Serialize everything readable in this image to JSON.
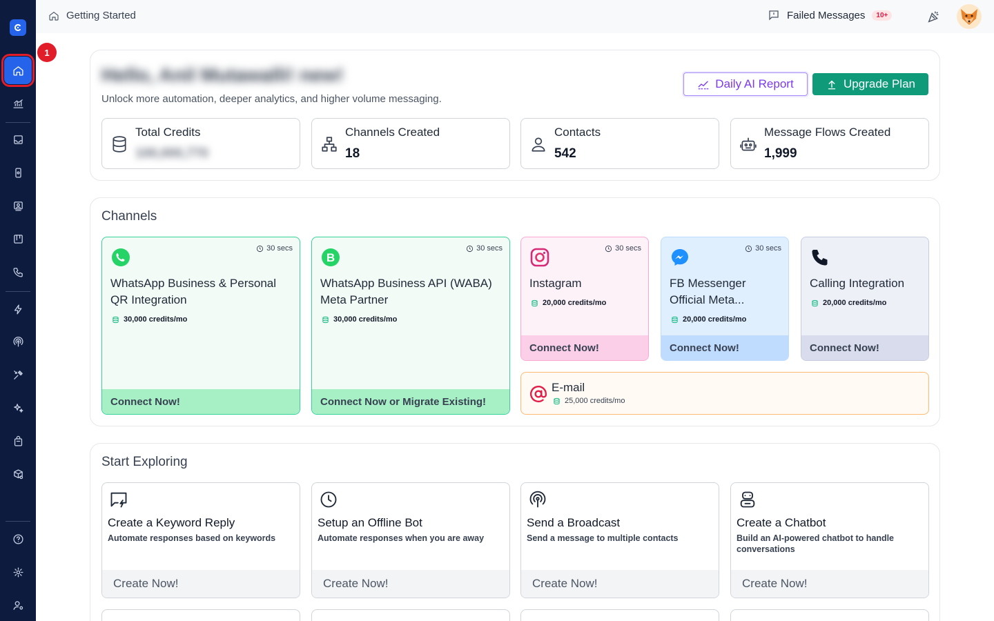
{
  "breadcrumb": {
    "label": "Getting Started"
  },
  "topbar": {
    "failed_label": "Failed Messages",
    "failed_count": "10+"
  },
  "tutorial": {
    "step": "1"
  },
  "hero": {
    "greeting": "Hello, Anil Mutawalli! new!",
    "subtitle": "Unlock more automation, deeper analytics, and higher volume messaging.",
    "ai_report_label": "Daily AI Report",
    "upgrade_label": "Upgrade Plan"
  },
  "stats": [
    {
      "label": "Total Credits",
      "value": "100,000,770",
      "icon": "database-icon"
    },
    {
      "label": "Channels Created",
      "value": "18",
      "icon": "hierarchy-icon"
    },
    {
      "label": "Contacts",
      "value": "542",
      "icon": "user-icon"
    },
    {
      "label": "Message Flows Created",
      "value": "1,999",
      "icon": "robot-icon"
    }
  ],
  "channels": {
    "title": "Channels",
    "items": [
      {
        "name": "WhatsApp Business & Personal QR Integration",
        "time": "30 secs",
        "credits": "30,000 credits/mo",
        "cta": "Connect Now!"
      },
      {
        "name": "WhatsApp Business API (WABA) Meta Partner",
        "time": "30 secs",
        "credits": "30,000 credits/mo",
        "cta": "Connect Now or Migrate Existing!"
      },
      {
        "name": "Instagram",
        "time": "30 secs",
        "credits": "20,000 credits/mo",
        "cta": "Connect Now!"
      },
      {
        "name": "FB Messenger Official Meta...",
        "time": "30 secs",
        "credits": "20,000 credits/mo",
        "cta": "Connect Now!"
      },
      {
        "name": "Calling Integration",
        "credits": "20,000 credits/mo",
        "cta": "Connect Now!"
      }
    ],
    "email": {
      "name": "E-mail",
      "credits": "25,000 credits/mo"
    }
  },
  "explore": {
    "title": "Start Exploring",
    "items": [
      {
        "title": "Create a Keyword Reply",
        "desc": "Automate responses based on keywords",
        "cta": "Create Now!"
      },
      {
        "title": "Setup an Offline Bot",
        "desc": "Automate responses when you are away",
        "cta": "Create Now!"
      },
      {
        "title": "Send a Broadcast",
        "desc": "Send a message to multiple contacts",
        "cta": "Create Now!"
      },
      {
        "title": "Create a Chatbot",
        "desc": "Build an AI-powered chatbot to handle conversations",
        "cta": "Create Now!"
      }
    ]
  },
  "colors": {
    "sidebar": "#0d1b3e",
    "accent": "#2563eb",
    "primary_button": "#0f9b7a",
    "ai_button": "#7c3aed",
    "alert": "#e11d2a"
  }
}
